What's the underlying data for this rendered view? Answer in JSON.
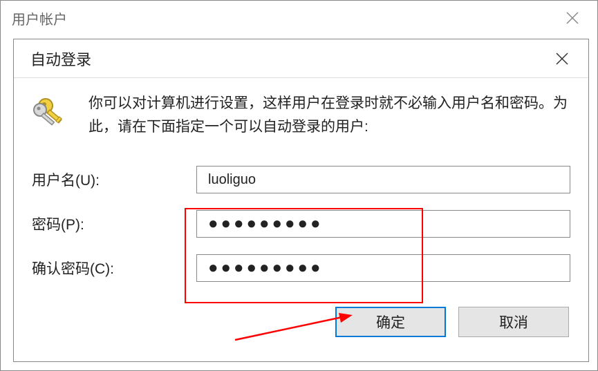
{
  "outerWindow": {
    "title": "用户帐户"
  },
  "dialog": {
    "title": "自动登录",
    "infoText": "你可以对计算机进行设置，这样用户在登录时就不必输入用户名和密码。为此，请在下面指定一个可以自动登录的用户:",
    "fields": {
      "usernameLabel": "用户名(U):",
      "usernameValue": "luoliguo",
      "passwordLabel": "密码(P):",
      "passwordValue": "●●●●●●●●●",
      "confirmLabel": "确认密码(C):",
      "confirmValue": "●●●●●●●●●"
    },
    "buttons": {
      "ok": "确定",
      "cancel": "取消"
    }
  }
}
